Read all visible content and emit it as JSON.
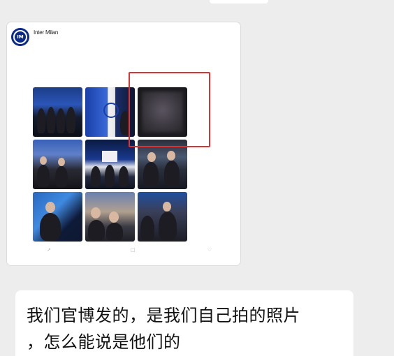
{
  "chat": {
    "shared_post": {
      "username": "Inter Milan",
      "time": "",
      "text_lines": [
        "",
        "",
        ""
      ],
      "link_text": "",
      "hashtag": "",
      "actions": [
        {
          "name": "share-icon",
          "glyph": "↗"
        },
        {
          "name": "comment-icon",
          "glyph": "□"
        },
        {
          "name": "like-icon",
          "glyph": "♡"
        }
      ],
      "photos": [
        {
          "name": "photo-team-group"
        },
        {
          "name": "photo-stage-logo"
        },
        {
          "name": "photo-blurred"
        },
        {
          "name": "photo-crowd"
        },
        {
          "name": "photo-ceremony"
        },
        {
          "name": "photo-players-smiling"
        },
        {
          "name": "photo-speaker"
        },
        {
          "name": "photo-fans-selfie"
        },
        {
          "name": "photo-press-crowd"
        }
      ],
      "highlight_color": "#e03232"
    },
    "reply_message": {
      "line1": "我们官博发的，是我们自己拍的照片",
      "line2": "，怎么能说是他们的"
    }
  }
}
